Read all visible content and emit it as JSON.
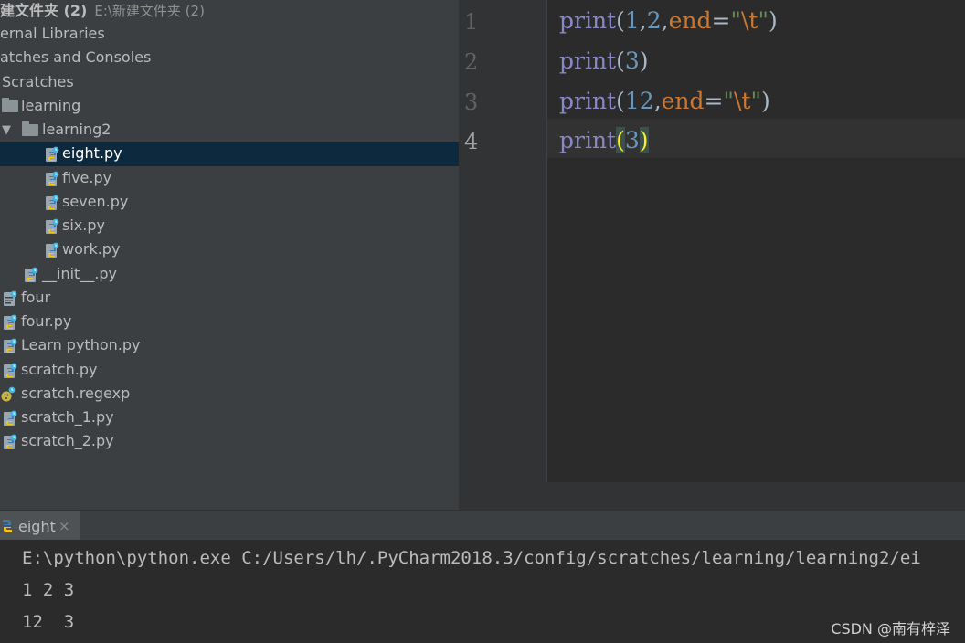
{
  "tree": {
    "root_label": "建文件夹 (2)",
    "root_path": "E:\\新建文件夹 (2)",
    "external_libraries": "ernal Libraries",
    "scratches_consoles": "atches and Consoles",
    "scratches": "Scratches",
    "folder_learning": "learning",
    "folder_learning2": "learning2",
    "files_learning2": [
      "eight.py",
      "five.py",
      "seven.py",
      "six.py",
      "work.py"
    ],
    "init_file": "__init__.py",
    "scratch_files": [
      "four",
      "four.py",
      "Learn python.py",
      "scratch.py",
      "scratch.regexp",
      "scratch_1.py",
      "scratch_2.py"
    ],
    "selected": "eight.py"
  },
  "editor": {
    "line_numbers": [
      "1",
      "2",
      "3",
      "4"
    ],
    "current_line": 4,
    "lines": [
      {
        "fn": "print",
        "open": "(",
        "a": "1",
        "c1": ",",
        "b": "2",
        "c2": ",",
        "kw": "end",
        "eq": "=",
        "q1": "\"",
        "esc": "\\t",
        "q2": "\"",
        "close": ")"
      },
      {
        "fn": "print",
        "open": "(",
        "a": "3",
        "close": ")"
      },
      {
        "fn": "print",
        "open": "(",
        "a": "12",
        "c1": ",",
        "kw": "end",
        "eq": "=",
        "q1": "\"",
        "esc": "\\t",
        "q2": "\"",
        "close": ")"
      },
      {
        "fn": "print",
        "open": "(",
        "a": "3",
        "close": ")"
      }
    ]
  },
  "run": {
    "tab_label": "eight",
    "tab_close": "×",
    "console_lines": [
      "E:\\python\\python.exe C:/Users/lh/.PyCharm2018.3/config/scratches/learning/learning2/ei",
      "1 2 3",
      "12  3"
    ]
  },
  "watermark": "CSDN @南有梓泽",
  "colors": {
    "tree_bg": "#3c3f41",
    "selection": "#0d293e",
    "editor_bg": "#2b2b2b",
    "keyword": "#8888c6",
    "number": "#6897bb",
    "named_param": "#cc7832",
    "string": "#6a8759",
    "brace_match": "#ffef28"
  }
}
